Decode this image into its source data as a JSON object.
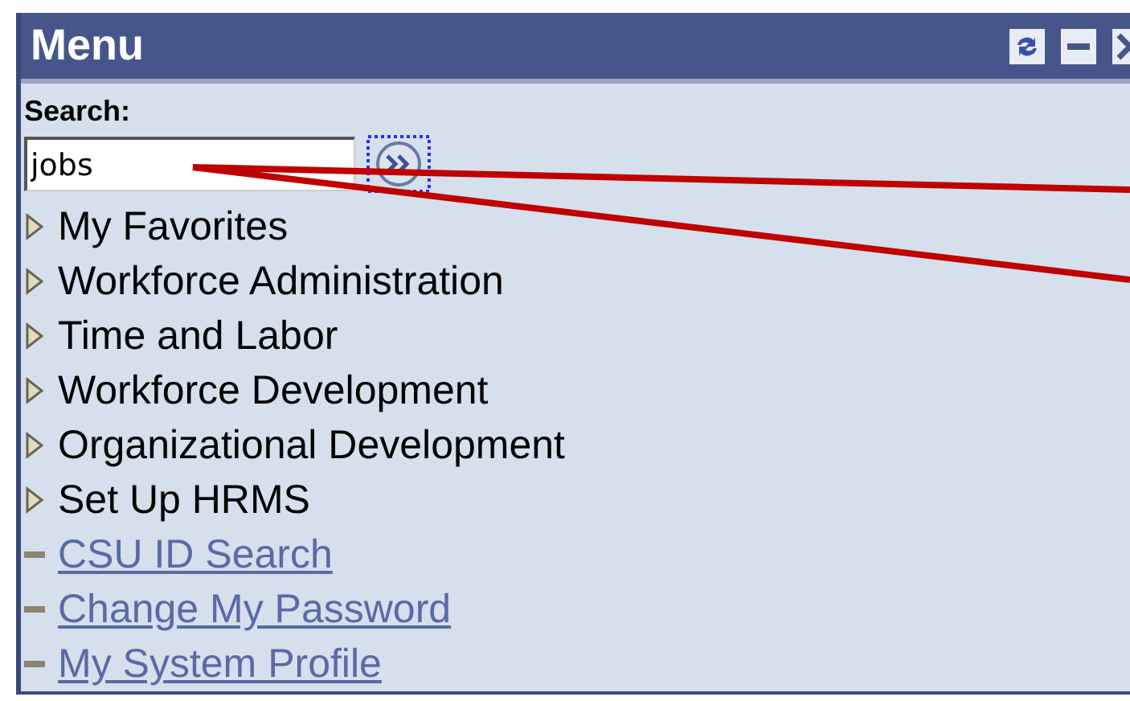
{
  "window": {
    "title": "Menu"
  },
  "search": {
    "label": "Search:",
    "value": "jobs"
  },
  "items": [
    {
      "label": "My Favorites",
      "kind": "folder"
    },
    {
      "label": "Workforce Administration",
      "kind": "folder"
    },
    {
      "label": "Time and Labor",
      "kind": "folder"
    },
    {
      "label": "Workforce Development",
      "kind": "folder"
    },
    {
      "label": "Organizational Development",
      "kind": "folder"
    },
    {
      "label": "Set Up HRMS",
      "kind": "folder"
    },
    {
      "label": "CSU ID Search",
      "kind": "link"
    },
    {
      "label": "Change My Password",
      "kind": "link"
    },
    {
      "label": "My System Profile",
      "kind": "link"
    }
  ]
}
